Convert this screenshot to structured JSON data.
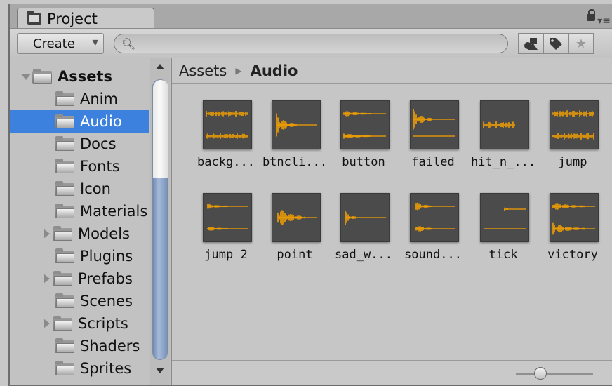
{
  "window": {
    "tab_label": "Project",
    "tab_icon": "folder-icon",
    "corner_icons": [
      "lock-icon",
      "menu-icon"
    ]
  },
  "toolbar": {
    "create_label": "Create",
    "search_placeholder": "",
    "buttons": [
      "filter-by-type-icon",
      "filter-by-label-icon",
      "favorites-star-icon"
    ]
  },
  "tree": {
    "root": "Assets",
    "items": [
      {
        "label": "Anim",
        "expandable": false,
        "selected": false
      },
      {
        "label": "Audio",
        "expandable": false,
        "selected": true
      },
      {
        "label": "Docs",
        "expandable": false,
        "selected": false
      },
      {
        "label": "Fonts",
        "expandable": false,
        "selected": false
      },
      {
        "label": "Icon",
        "expandable": false,
        "selected": false
      },
      {
        "label": "Materials",
        "expandable": false,
        "selected": false
      },
      {
        "label": "Models",
        "expandable": true,
        "selected": false
      },
      {
        "label": "Plugins",
        "expandable": false,
        "selected": false
      },
      {
        "label": "Prefabs",
        "expandable": true,
        "selected": false
      },
      {
        "label": "Scenes",
        "expandable": false,
        "selected": false
      },
      {
        "label": "Scripts",
        "expandable": true,
        "selected": false
      },
      {
        "label": "Shaders",
        "expandable": false,
        "selected": false
      },
      {
        "label": "Sprites",
        "expandable": false,
        "selected": false
      }
    ]
  },
  "breadcrumb": {
    "root": "Assets",
    "current": "Audio"
  },
  "assets": [
    {
      "label": "backg..."
    },
    {
      "label": "btncli..."
    },
    {
      "label": "button"
    },
    {
      "label": "failed"
    },
    {
      "label": "hit_n_..."
    },
    {
      "label": "jump"
    },
    {
      "label": "jump 2"
    },
    {
      "label": "point"
    },
    {
      "label": "sad_w..."
    },
    {
      "label": "sound..."
    },
    {
      "label": "tick"
    },
    {
      "label": "victory"
    }
  ],
  "colors": {
    "selection": "#3c81de",
    "waveform": "#f5a000",
    "thumb_bg": "#4b4b4b"
  }
}
